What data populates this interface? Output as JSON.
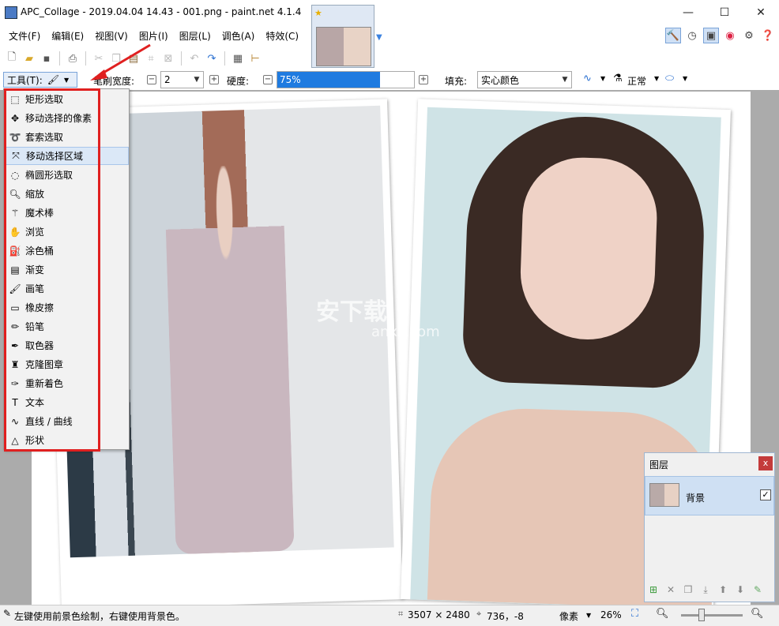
{
  "window": {
    "title": "APC_Collage - 2019.04.04 14.43 - 001.png - paint.net 4.1.4",
    "minimize": "—",
    "maximize": "☐",
    "close": "✕"
  },
  "menu": [
    "文件(F)",
    "编辑(E)",
    "视图(V)",
    "图片(I)",
    "图层(L)",
    "调色(A)",
    "特效(C)"
  ],
  "toolbar2": {
    "tools_label": "工具(T):",
    "brush_width_label": "笔刷宽度:",
    "brush_width_value": "2",
    "hardness_label": "硬度:",
    "hardness_value": "75%",
    "hardness_fraction": 0.75,
    "fill_label": "填充:",
    "fill_value": "实心颜色",
    "blend_value": "正常"
  },
  "tools_menu": [
    {
      "label": "矩形选取",
      "icon": "rectangle-select-icon"
    },
    {
      "label": "移动选择的像素",
      "icon": "move-pixels-icon"
    },
    {
      "label": "套索选取",
      "icon": "lasso-icon"
    },
    {
      "label": "移动选择区域",
      "icon": "move-selection-icon",
      "highlighted": true
    },
    {
      "label": "椭圆形选取",
      "icon": "ellipse-select-icon"
    },
    {
      "label": "缩放",
      "icon": "zoom-icon"
    },
    {
      "label": "魔术棒",
      "icon": "magic-wand-icon"
    },
    {
      "label": "浏览",
      "icon": "pan-hand-icon"
    },
    {
      "label": "涂色桶",
      "icon": "paint-bucket-icon"
    },
    {
      "label": "渐变",
      "icon": "gradient-icon"
    },
    {
      "label": "画笔",
      "icon": "paintbrush-icon"
    },
    {
      "label": "橡皮擦",
      "icon": "eraser-icon"
    },
    {
      "label": "铅笔",
      "icon": "pencil-icon"
    },
    {
      "label": "取色器",
      "icon": "color-picker-icon"
    },
    {
      "label": "克隆图章",
      "icon": "clone-stamp-icon"
    },
    {
      "label": "重新着色",
      "icon": "recolor-icon"
    },
    {
      "label": "文本",
      "icon": "text-icon"
    },
    {
      "label": "直线 / 曲线",
      "icon": "line-curve-icon"
    },
    {
      "label": "形状",
      "icon": "shapes-icon"
    }
  ],
  "watermark": {
    "main": "安下载",
    "sub": "anxz.com"
  },
  "layers": {
    "title": "图层",
    "close": "x",
    "items": [
      {
        "name": "背景",
        "visible": "☑"
      }
    ]
  },
  "status": {
    "hint": "左键使用前景色绘制，右键使用背景色。",
    "image_size": "3507 × 2480",
    "cursor_pos": "736，-8",
    "unit": "像素",
    "zoom": "26%"
  },
  "colors": {
    "highlight": "#dbe8f7",
    "annotation_red": "#e02020",
    "hardness_blue": "#1f7be0"
  }
}
